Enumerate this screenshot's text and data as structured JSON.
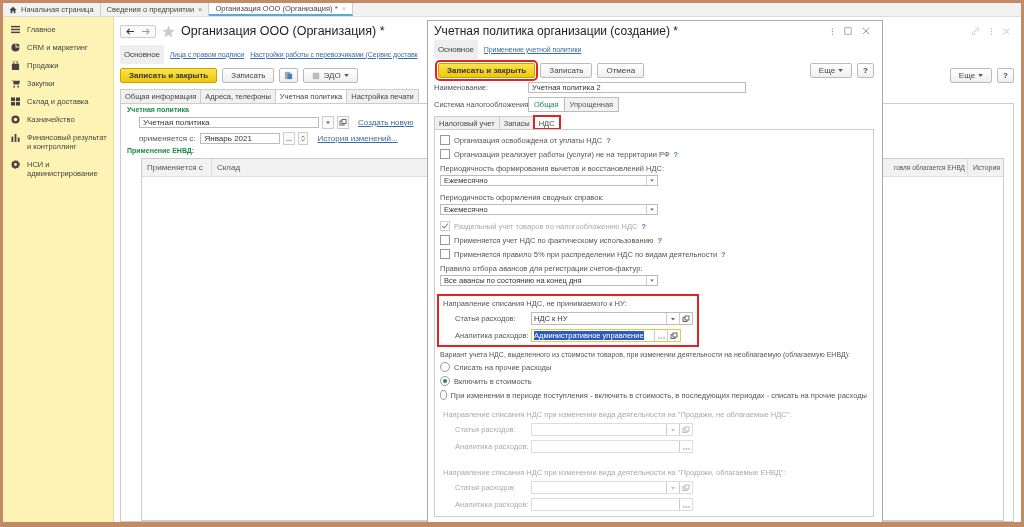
{
  "top_tabs": [
    {
      "kind": "home",
      "label": "Начальная страница",
      "selected": false
    },
    {
      "kind": "page",
      "label": "Сведения о предприятии",
      "close": "×",
      "selected": false
    },
    {
      "kind": "page",
      "label": "Организация ООО (Организация) *",
      "close": "×",
      "selected": true
    }
  ],
  "sidebar": {
    "items": [
      {
        "label": "Главное"
      },
      {
        "label": "CRM и маркетинг"
      },
      {
        "label": "Продажи"
      },
      {
        "label": "Закупки"
      },
      {
        "label": "Склад и доставка"
      },
      {
        "label": "Казначейство"
      },
      {
        "label": "Финансовый результат и контроллинг"
      },
      {
        "label": "НСИ и администрирование"
      }
    ]
  },
  "form": {
    "title": "Организация ООО (Организация) *",
    "sections": [
      {
        "label": "Основное",
        "selected": true
      },
      {
        "label": "Лица с правом подписи",
        "selected": false
      },
      {
        "label": "Настройки работы с перевозчиками (Сервис доставк",
        "selected": false
      }
    ],
    "buttons": [
      {
        "kind": "primary",
        "label": "Записать и закрыть"
      },
      {
        "kind": "plain",
        "label": "Записать"
      },
      {
        "kind": "icon"
      },
      {
        "kind": "menu",
        "label": "ЭДО"
      }
    ],
    "more_button": "Еще",
    "help_button": "?",
    "tabs": [
      {
        "label": "Общая информация",
        "selected": false
      },
      {
        "label": "Адреса, телефоны",
        "selected": false
      },
      {
        "label": "Учетная политика",
        "selected": true
      },
      {
        "label": "Настройка печати",
        "selected": false
      }
    ],
    "policy_heading": "Учетная политика",
    "policy_value": "Учетная политика",
    "create_link": "Создать новую",
    "applies_label": "применяется с:",
    "applies_value": "Январь 2021",
    "history_link": "История изменений...",
    "envd_heading": "Применение ЕНВД:",
    "table": {
      "columns": [
        {
          "label": "Применяется с"
        },
        {
          "label": "Склад"
        },
        {
          "label": "говля облагается ЕНВД"
        },
        {
          "label": "История"
        }
      ]
    }
  },
  "dialog": {
    "title": "Учетная политика организации (создание) *",
    "sections": [
      {
        "label": "Основное",
        "selected": true
      },
      {
        "label": "Применение учетной политики",
        "selected": false
      }
    ],
    "buttons": [
      {
        "kind": "primary",
        "label": "Записать и закрыть",
        "highlighted": true
      },
      {
        "kind": "plain",
        "label": "Записать",
        "highlighted": false
      },
      {
        "kind": "plain",
        "label": "Отмена",
        "highlighted": false
      }
    ],
    "more_button": "Еще",
    "help_button": "?",
    "name_label": "Наименование:",
    "name_value": "Учетная политика 2",
    "tax_label": "Система налогообложения:",
    "tax_options": [
      {
        "label": "Общая",
        "selected": true
      },
      {
        "label": "Упрощенная",
        "selected": false
      }
    ],
    "tabs": [
      {
        "label": "Налоговый учет",
        "selected": false,
        "highlighted": false
      },
      {
        "label": "Запасы",
        "selected": false,
        "highlighted": false
      },
      {
        "label": "НДС",
        "selected": true,
        "highlighted": true
      }
    ],
    "items": [
      {
        "kind": "checkbox",
        "label": "Организация освобождена от уплаты НДС",
        "help": "?",
        "checked": false,
        "disabled": false
      },
      {
        "kind": "checkbox",
        "label": "Организация реализует работы (услуги) не на территории РФ",
        "help": "?",
        "checked": false,
        "disabled": false
      },
      {
        "kind": "select",
        "label": "Периодичность формирования вычетов и восстановлений НДС:",
        "value": "Ежемесячно"
      },
      {
        "kind": "select",
        "label": "Периодичность оформления сводных справок:",
        "value": "Ежемесячно"
      },
      {
        "kind": "checkbox",
        "label": "Раздельный учет товаров по налогообложению НДС",
        "help": "?",
        "checked": true,
        "disabled": true
      },
      {
        "kind": "checkbox",
        "label": "Применяется учет НДС по фактическому использованию",
        "help": "?",
        "checked": false,
        "disabled": false
      },
      {
        "kind": "checkbox",
        "label": "Применяется правило 5% при распределении НДС по видам деятельности",
        "help": "?",
        "checked": false,
        "disabled": false
      },
      {
        "kind": "select",
        "label": "Правило отбора авансов для регистрации счетов-фактур:",
        "value": "Все авансы по состоянию на конец дня"
      },
      {
        "kind": "group",
        "label": "Направление списания НДС, не принимаемого к НУ:",
        "highlighted": true,
        "disabled": false,
        "fields": [
          {
            "label": "Статья расходов:",
            "value": "НДС к НУ",
            "kind": "select",
            "openable": true,
            "focused": false
          },
          {
            "label": "Аналитика расходов:",
            "value": "Административное управление",
            "kind": "choice",
            "openable": true,
            "focused": true
          }
        ]
      },
      {
        "kind": "radios",
        "label": "Вариант учета НДС, выделенного из стоимости товаров, при изменении деятельности на необлагаемую (облагаемую ЕНВД):",
        "options": [
          {
            "label": "Списать на прочие расходы",
            "selected": false
          },
          {
            "label": "Включить в стоимость",
            "selected": true
          },
          {
            "label": "При изменении в периоде поступления - включить в стоимость, в последующих периодах - списать на прочие расходы",
            "selected": false
          }
        ]
      },
      {
        "kind": "group",
        "label": "Направление списания НДС при изменении вида деятельности на \"Продажи, не облагаемые НДС\":",
        "highlighted": false,
        "disabled": true,
        "fields": [
          {
            "label": "Статья расходов:",
            "kind": "select",
            "openable": true,
            "focused": false
          },
          {
            "label": "Аналитика расходов:",
            "kind": "choice",
            "openable": false,
            "focused": false
          }
        ]
      },
      {
        "kind": "group",
        "label": "Направление списания НДС при изменении вида деятельности на \"Продажи, облагаемые ЕНВД\":",
        "highlighted": false,
        "disabled": true,
        "fields": [
          {
            "label": "Статья расходов:",
            "kind": "select",
            "openable": true,
            "focused": false
          },
          {
            "label": "Аналитика расходов:",
            "kind": "choice",
            "openable": false,
            "focused": false
          }
        ]
      }
    ]
  }
}
